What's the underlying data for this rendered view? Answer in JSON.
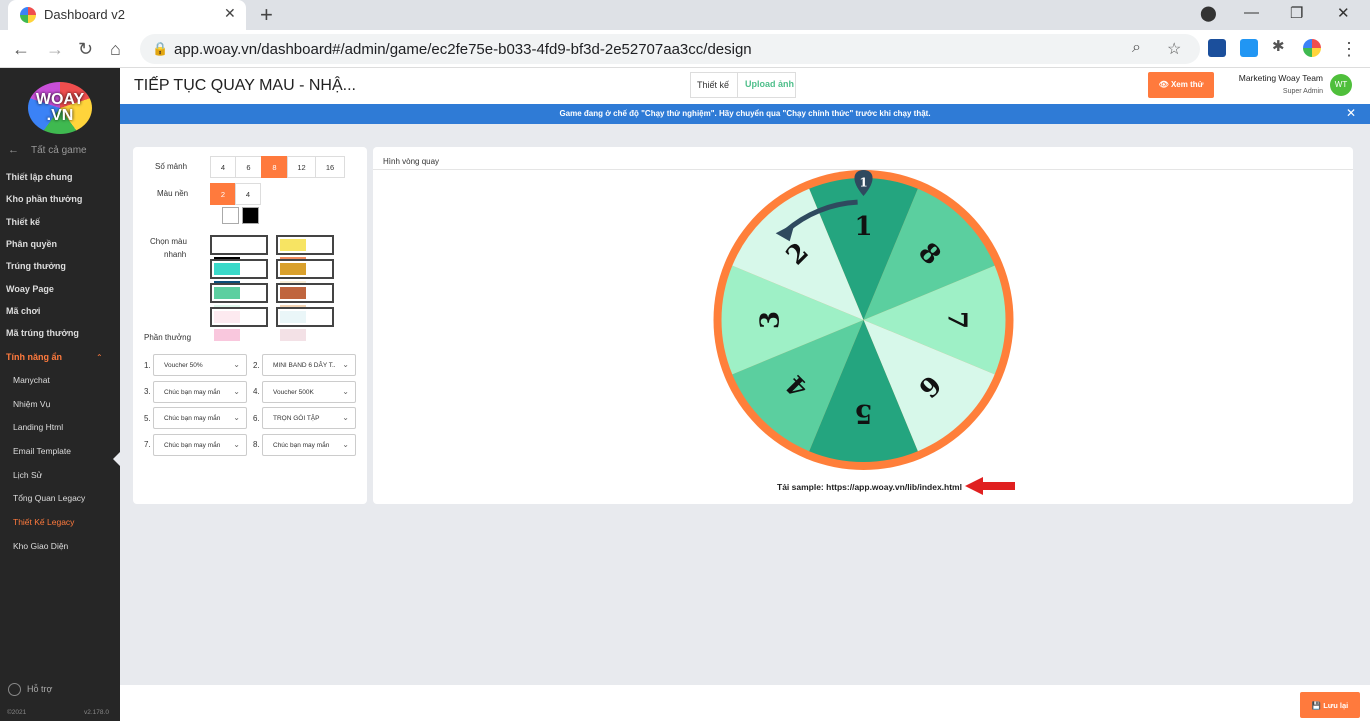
{
  "browser": {
    "tab_title": "Dashboard v2",
    "url": "app.woay.vn/dashboard#/admin/game/ec2fe75e-b033-4fd9-bf3d-2e52707aa3cc/design"
  },
  "sidebar": {
    "logo_text": "WOAY.VN",
    "back_label": "Tất cả game",
    "items": [
      {
        "label": "Thiết lập chung"
      },
      {
        "label": "Kho phần thưởng"
      },
      {
        "label": "Thiết kế"
      },
      {
        "label": "Phân quyền"
      },
      {
        "label": "Trúng thưởng"
      },
      {
        "label": "Woay Page"
      },
      {
        "label": "Mã chơi"
      },
      {
        "label": "Mã trúng thưởng"
      },
      {
        "label": "Tính năng ẩn"
      }
    ],
    "sub_items": [
      {
        "label": "Manychat"
      },
      {
        "label": "Nhiệm Vụ"
      },
      {
        "label": "Landing Html"
      },
      {
        "label": "Email Template"
      },
      {
        "label": "Lịch Sử"
      },
      {
        "label": "Tổng Quan Legacy"
      },
      {
        "label": "Thiết Kế Legacy"
      },
      {
        "label": "Kho Giao Diện"
      }
    ],
    "help": "Hỗ trợ",
    "copyright": "©2021",
    "version": "v2.178.0"
  },
  "header": {
    "title": "TIẾP TỤC QUAY MAU - NHẬ...",
    "tab_design": "Thiết kế",
    "tab_upload": "Upload ảnh",
    "try_button": "👁 Xem thử",
    "team_name": "Marketing Woay Team",
    "role": "Super Admin",
    "avatar_initials": "WT"
  },
  "banner": "Game đang ở chế độ \"Chạy thử nghiệm\". Hãy chuyển qua \"Chạy chính thức\" trước khi chạy thật.",
  "settings": {
    "pieces_label": "Số mảnh",
    "pieces_options": [
      "4",
      "6",
      "8",
      "12",
      "16"
    ],
    "pieces_selected": "8",
    "bg_color_label": "Màu nền",
    "bg_color_options": [
      "2",
      "4"
    ],
    "bg_color_selected": "2",
    "bg_swatches": [
      "#ffffff",
      "#000000"
    ],
    "quick_color_label_1": "Chọn màu",
    "quick_color_label_2": "nhanh",
    "palettes": [
      [
        "#ffffff",
        "#000000"
      ],
      [
        "#f7e463",
        "#f08a5d"
      ],
      [
        "#3ad9c9",
        "#0b4f7a"
      ],
      [
        "#d9a02c",
        "#fbefd8"
      ],
      [
        "#5ccfa0",
        "#dff6ec"
      ],
      [
        "#c0653e",
        "#f3d4b4"
      ],
      [
        "#fdeaf0",
        "#f9c7dd"
      ],
      [
        "#eaf6f8",
        "#f3e1e6"
      ]
    ],
    "prizes_label": "Phần thưởng",
    "prizes": [
      {
        "num": "1.",
        "value": "Voucher 50%"
      },
      {
        "num": "2.",
        "value": "MINI BAND 6 DÂY T.."
      },
      {
        "num": "3.",
        "value": "Chúc bạn may mắn"
      },
      {
        "num": "4.",
        "value": "Voucher 500K"
      },
      {
        "num": "5.",
        "value": "Chúc bạn may mắn"
      },
      {
        "num": "6.",
        "value": "TRỌN GÓI TẬP"
      },
      {
        "num": "7.",
        "value": "Chúc bạn may mắn"
      },
      {
        "num": "8.",
        "value": "Chúc bạn may mắn"
      }
    ]
  },
  "preview": {
    "title": "Hình vòng quay",
    "wheel_numbers": [
      "1",
      "8",
      "7",
      "6",
      "5",
      "4",
      "3",
      "2"
    ],
    "wheel_colors": [
      "#24a57f",
      "#5bcf9f",
      "#9ef0c6",
      "#d7f8ea",
      "#24a57f",
      "#5bcf9f",
      "#9ef0c6",
      "#d7f8ea"
    ],
    "rim_color": "#ff7f3a",
    "pin_label": "1",
    "sample_text": "Tải sample: https://app.woay.vn/lib/index.html"
  },
  "footer": {
    "save_button": "💾 Lưu lại"
  }
}
